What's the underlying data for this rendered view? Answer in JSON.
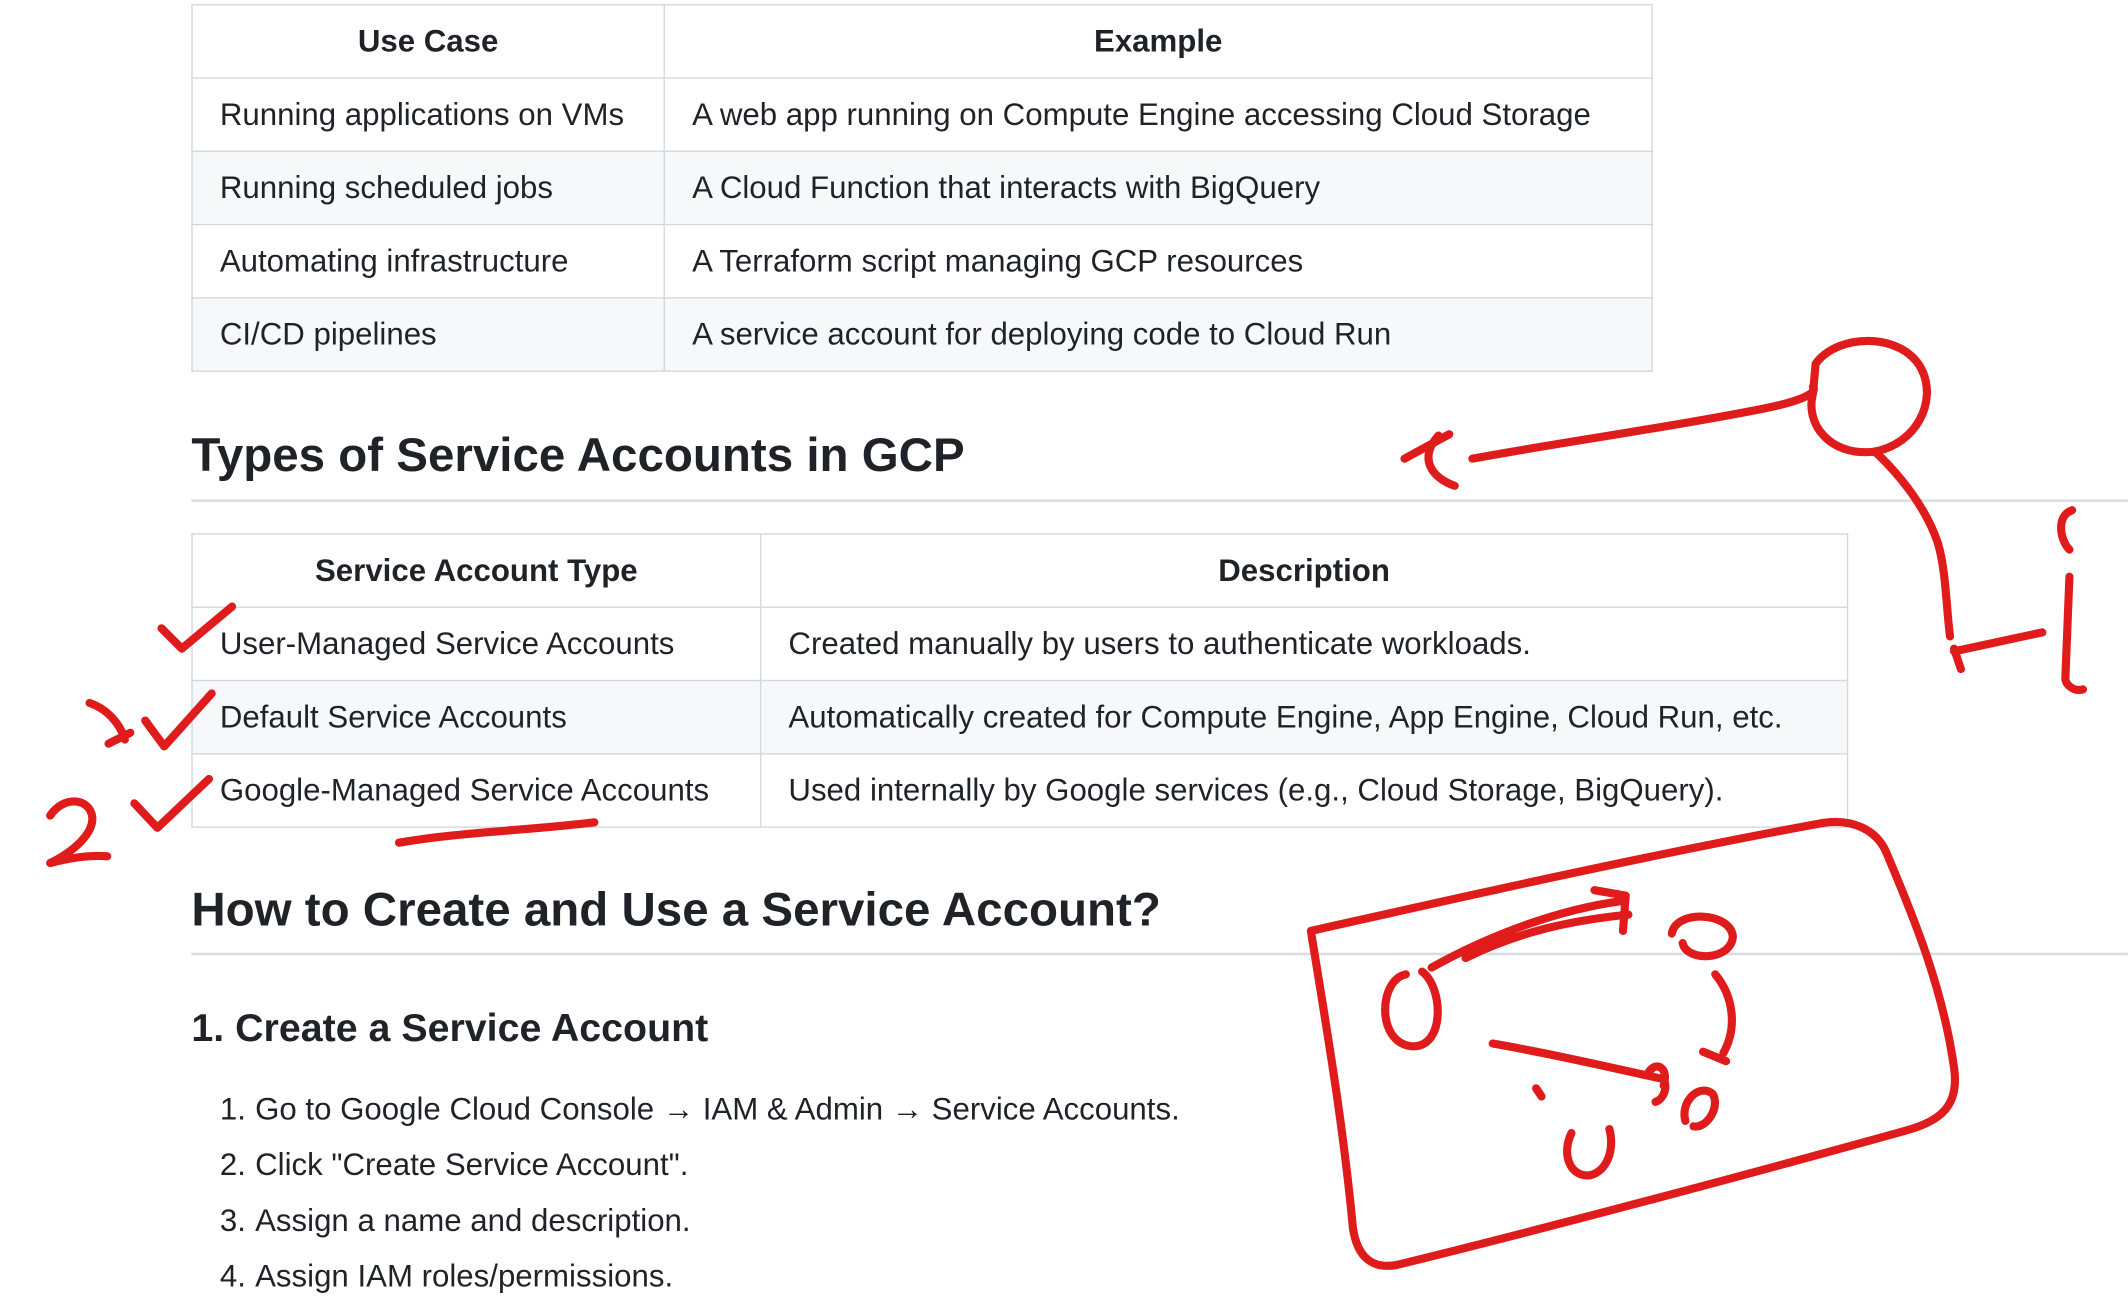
{
  "use_cases_table": {
    "headers": [
      "Use Case",
      "Example"
    ],
    "rows": [
      [
        "Running applications on VMs",
        "A web app running on Compute Engine accessing Cloud Storage"
      ],
      [
        "Running scheduled jobs",
        "A Cloud Function that interacts with BigQuery"
      ],
      [
        "Automating infrastructure",
        "A Terraform script managing GCP resources"
      ],
      [
        "CI/CD pipelines",
        "A service account for deploying code to Cloud Run"
      ]
    ]
  },
  "types_heading": "Types of Service Accounts in GCP",
  "types_table": {
    "headers": [
      "Service Account Type",
      "Description"
    ],
    "rows": [
      [
        "User-Managed Service Accounts",
        "Created manually by users to authenticate workloads."
      ],
      [
        "Default Service Accounts",
        "Automatically created for Compute Engine, App Engine, Cloud Run, etc."
      ],
      [
        "Google-Managed Service Accounts",
        "Used internally by Google services (e.g., Cloud Storage, BigQuery)."
      ]
    ]
  },
  "howto_heading": "How to Create and Use a Service Account?",
  "create_heading": "1. Create a Service Account",
  "steps": [
    {
      "num": "1.",
      "text": "Go to Google Cloud Console → IAM & Admin → Service Accounts."
    },
    {
      "num": "2.",
      "text": "Click \"Create Service Account\"."
    },
    {
      "num": "3.",
      "text": "Assign a name and description."
    },
    {
      "num": "4.",
      "text": "Assign IAM roles/permissions."
    }
  ],
  "annotation_color": "#e01b1b"
}
